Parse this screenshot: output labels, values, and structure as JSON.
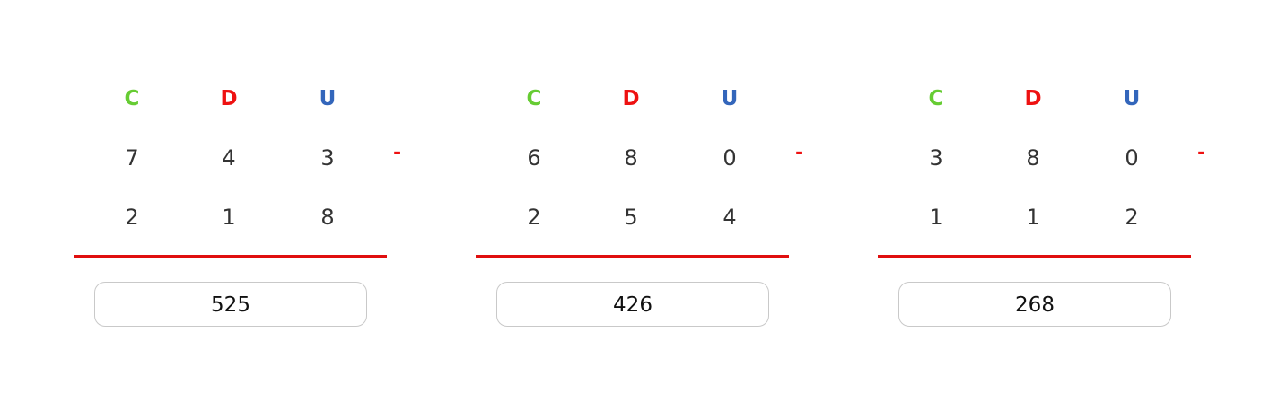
{
  "headers": {
    "c": "C",
    "d": "D",
    "u": "U"
  },
  "operator": "-",
  "problems": [
    {
      "top": [
        "7",
        "4",
        "3"
      ],
      "bottom": [
        "2",
        "1",
        "8"
      ],
      "answer": "525"
    },
    {
      "top": [
        "6",
        "8",
        "0"
      ],
      "bottom": [
        "2",
        "5",
        "4"
      ],
      "answer": "426"
    },
    {
      "top": [
        "3",
        "8",
        "0"
      ],
      "bottom": [
        "1",
        "1",
        "2"
      ],
      "answer": "268"
    }
  ],
  "colors": {
    "hundreds": "#66cc33",
    "tens": "#ee1111",
    "units": "#3366bb",
    "operator_and_rule": "#ee1111"
  }
}
